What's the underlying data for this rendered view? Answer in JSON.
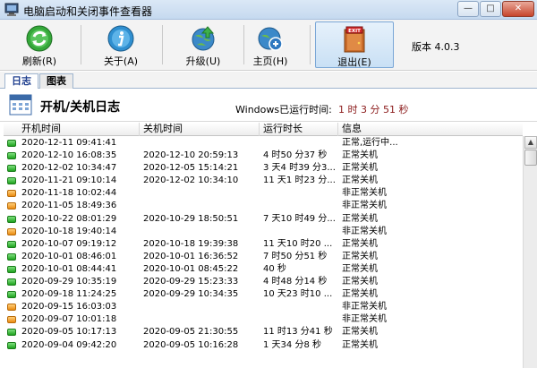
{
  "window": {
    "title": "电脑启动和关闭事件查看器",
    "min_label": "—",
    "max_label": "□",
    "close_label": "✕"
  },
  "toolbar": {
    "refresh_label": "刷新(R)",
    "about_label": "关于(A)",
    "upgrade_label": "升级(U)",
    "home_label": "主页(H)",
    "exit_label": "退出(E)",
    "exit_sign": "EXIT",
    "version": "版本 4.0.3"
  },
  "tabs": {
    "log": "日志",
    "chart": "图表"
  },
  "header": {
    "title": "开机/关机日志",
    "uptime_label": "Windows已运行时间:",
    "uptime_value": "1 时 3 分 51 秒"
  },
  "table": {
    "columns": [
      "开机时间",
      "关机时间",
      "运行时长",
      "信息"
    ],
    "rows": [
      {
        "status": "ok",
        "on": "2020-12-11 09:41:41",
        "off": "",
        "dur": "",
        "info": "正常,运行中..."
      },
      {
        "status": "ok",
        "on": "2020-12-10 16:08:35",
        "off": "2020-12-10 20:59:13",
        "dur": "4 时50 分37 秒",
        "info": "正常关机"
      },
      {
        "status": "ok",
        "on": "2020-12-02 10:34:47",
        "off": "2020-12-05 15:14:21",
        "dur": "3 天4 时39 分3...",
        "info": "正常关机"
      },
      {
        "status": "ok",
        "on": "2020-11-21 09:10:14",
        "off": "2020-12-02 10:34:10",
        "dur": "11 天1 时23 分...",
        "info": "正常关机"
      },
      {
        "status": "bad",
        "on": "2020-11-18 10:02:44",
        "off": "",
        "dur": "",
        "info": "非正常关机"
      },
      {
        "status": "bad",
        "on": "2020-11-05 18:49:36",
        "off": "",
        "dur": "",
        "info": "非正常关机"
      },
      {
        "status": "ok",
        "on": "2020-10-22 08:01:29",
        "off": "2020-10-29 18:50:51",
        "dur": "7 天10 时49 分...",
        "info": "正常关机"
      },
      {
        "status": "bad",
        "on": "2020-10-18 19:40:14",
        "off": "",
        "dur": "",
        "info": "非正常关机"
      },
      {
        "status": "ok",
        "on": "2020-10-07 09:19:12",
        "off": "2020-10-18 19:39:38",
        "dur": "11 天10 时20 ...",
        "info": "正常关机"
      },
      {
        "status": "ok",
        "on": "2020-10-01 08:46:01",
        "off": "2020-10-01 16:36:52",
        "dur": "7 时50 分51 秒",
        "info": "正常关机"
      },
      {
        "status": "ok",
        "on": "2020-10-01 08:44:41",
        "off": "2020-10-01 08:45:22",
        "dur": "40 秒",
        "info": "正常关机"
      },
      {
        "status": "ok",
        "on": "2020-09-29 10:35:19",
        "off": "2020-09-29 15:23:33",
        "dur": "4 时48 分14 秒",
        "info": "正常关机"
      },
      {
        "status": "ok",
        "on": "2020-09-18 11:24:25",
        "off": "2020-09-29 10:34:35",
        "dur": "10 天23 时10 ...",
        "info": "正常关机"
      },
      {
        "status": "bad",
        "on": "2020-09-15 16:03:03",
        "off": "",
        "dur": "",
        "info": "非正常关机"
      },
      {
        "status": "bad",
        "on": "2020-09-07 10:01:18",
        "off": "",
        "dur": "",
        "info": "非正常关机"
      },
      {
        "status": "ok",
        "on": "2020-09-05 10:17:13",
        "off": "2020-09-05 21:30:55",
        "dur": "11 时13 分41 秒",
        "info": "正常关机"
      },
      {
        "status": "ok",
        "on": "2020-09-04 09:42:20",
        "off": "2020-09-05 10:16:28",
        "dur": "1 天34 分8 秒",
        "info": "正常关机"
      }
    ]
  },
  "colors": {
    "ok": "#1ea21e",
    "bad": "#ea8a10",
    "uptime": "#8b1a1a"
  }
}
